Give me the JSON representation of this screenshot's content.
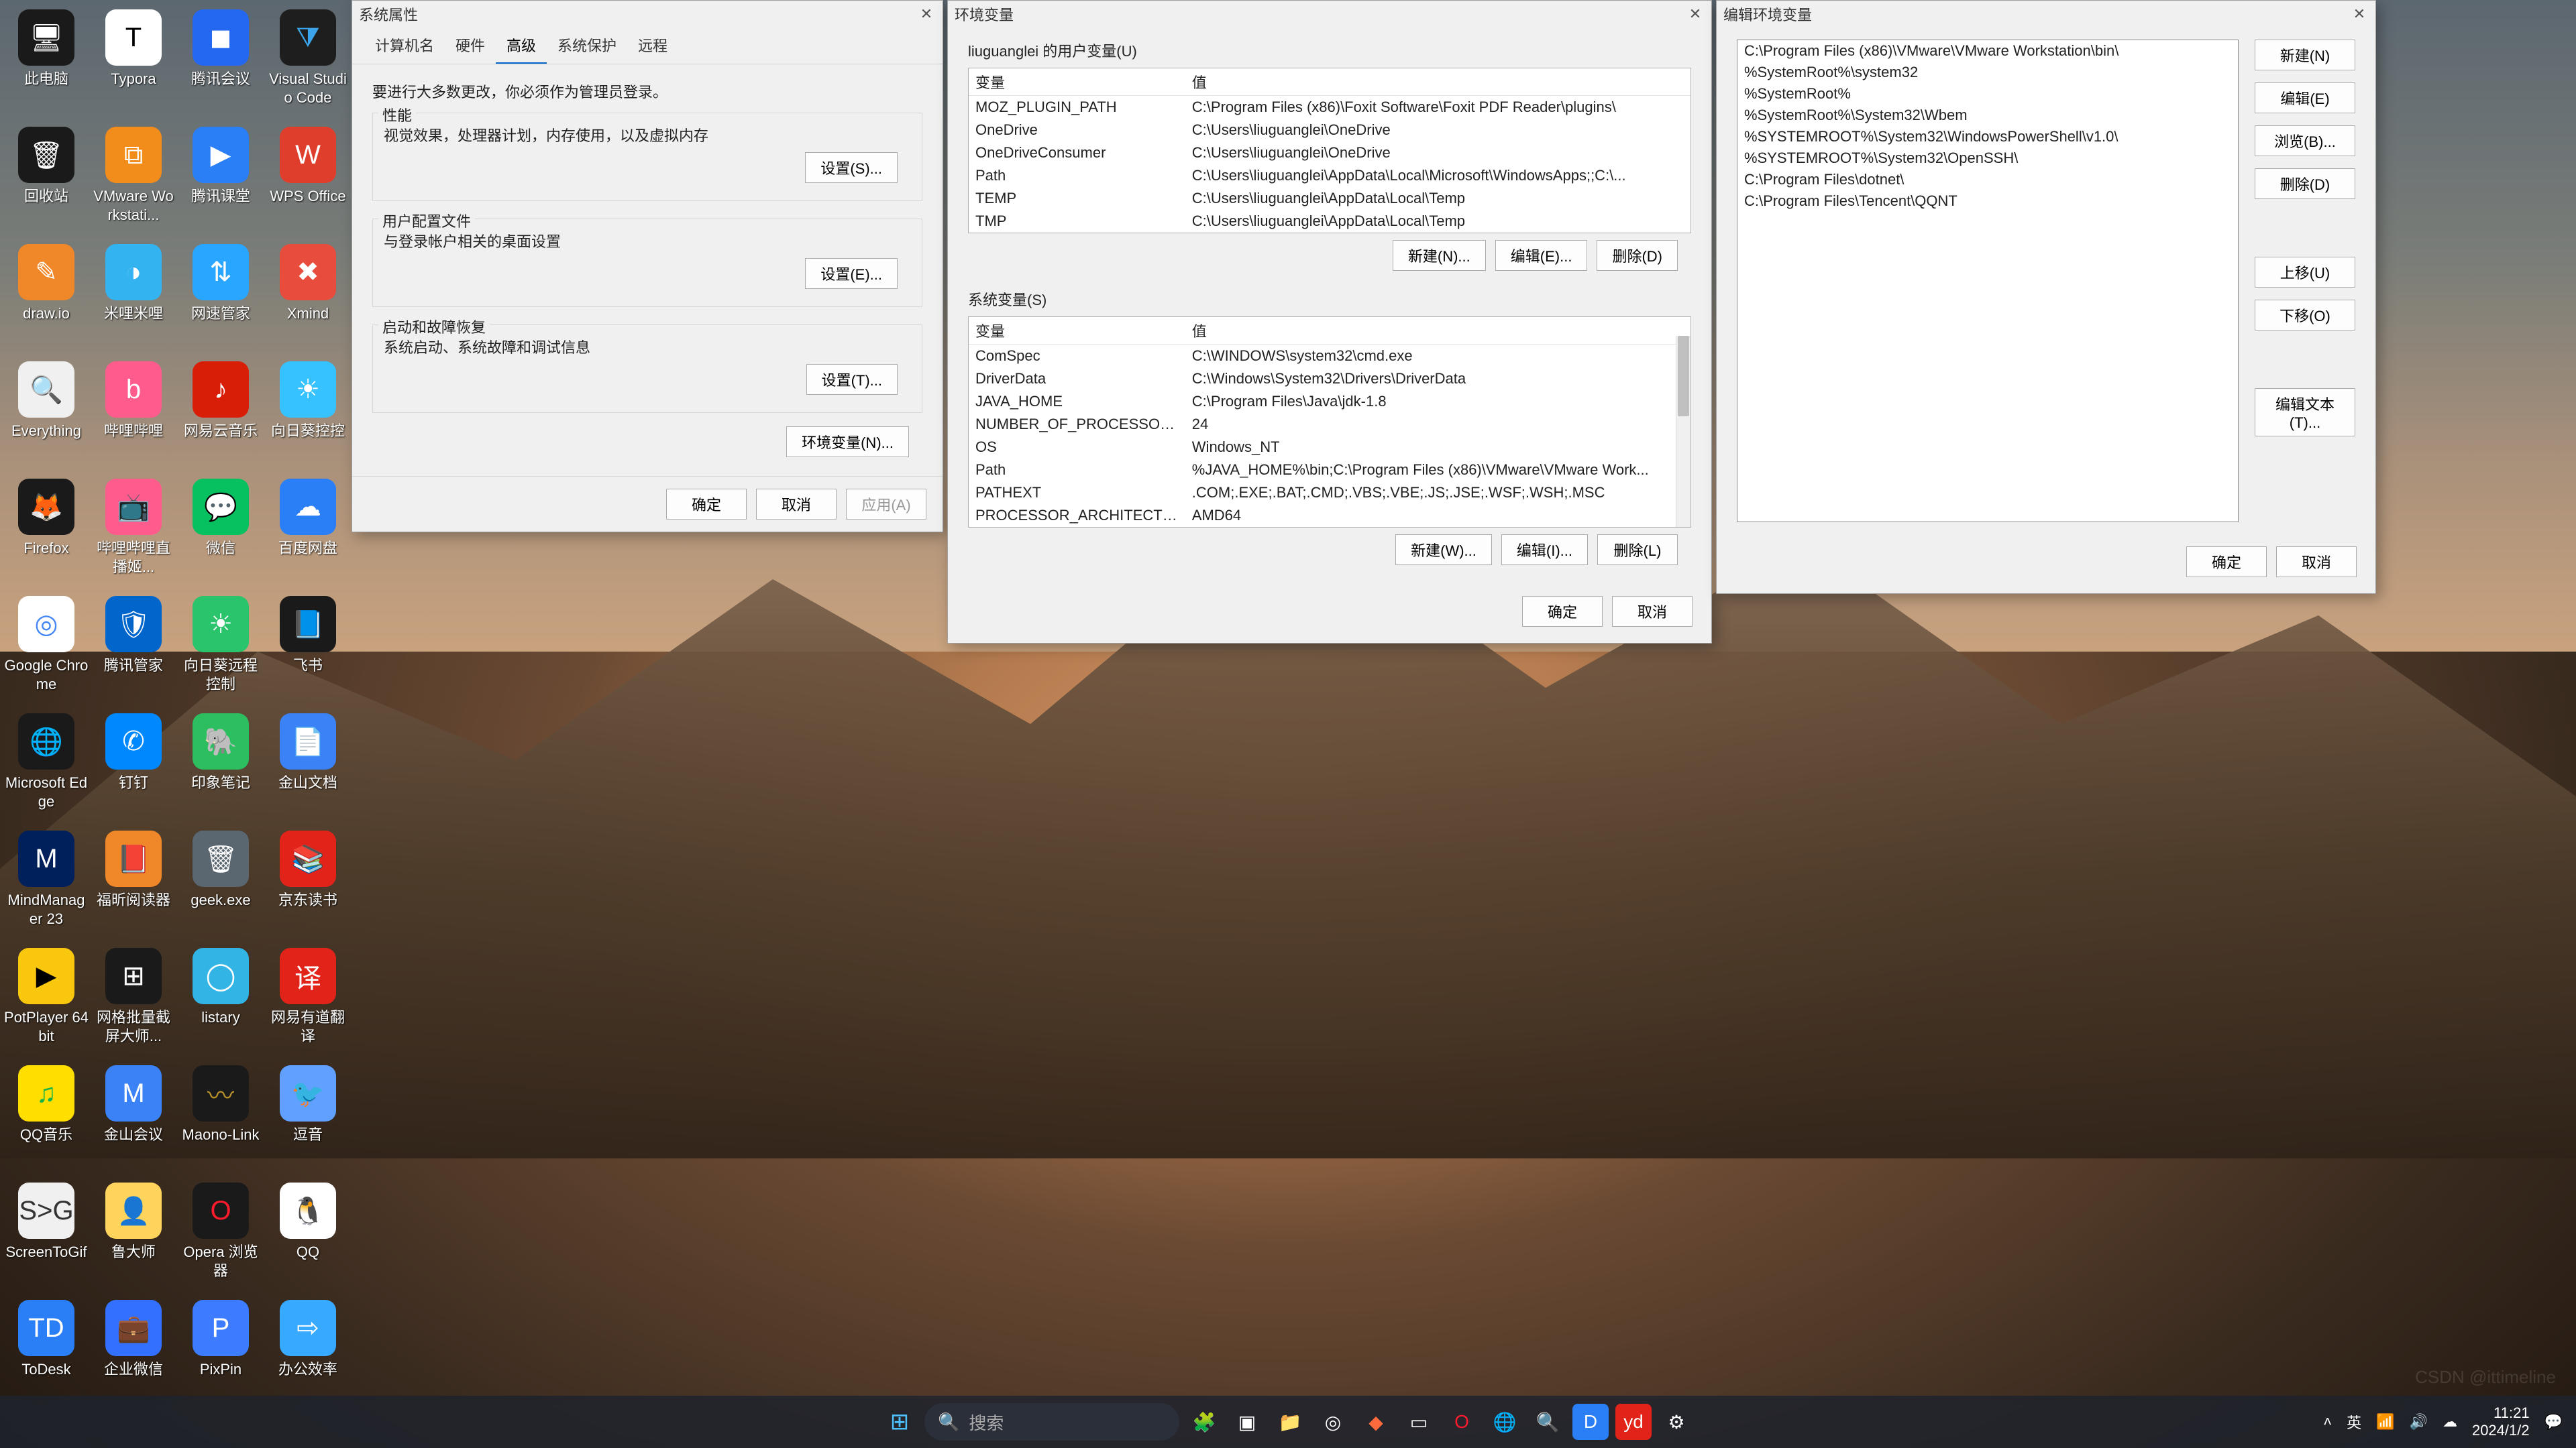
{
  "desktop_icons": [
    {
      "label": "此电脑",
      "bg": "#1a1a1a",
      "glyph": "🖥"
    },
    {
      "label": "Typora",
      "bg": "#ffffff",
      "glyph": "T",
      "fg": "#000"
    },
    {
      "label": "腾讯会议",
      "bg": "#2468f2",
      "glyph": "◼"
    },
    {
      "label": "Visual Studio Code",
      "bg": "#1e1e1e",
      "glyph": "⧩",
      "fg": "#3ba4ea"
    },
    {
      "label": "回收站",
      "bg": "#1a1a1a",
      "glyph": "🗑"
    },
    {
      "label": "VMware Workstati...",
      "bg": "#f28c1b",
      "glyph": "⧉"
    },
    {
      "label": "腾讯课堂",
      "bg": "#2a7ef6",
      "glyph": "▶"
    },
    {
      "label": "WPS Office",
      "bg": "#e03e2d",
      "glyph": "W"
    },
    {
      "label": "draw.io",
      "bg": "#f08728",
      "glyph": "✎"
    },
    {
      "label": "米哩米哩",
      "bg": "#34b3f1",
      "glyph": "◑"
    },
    {
      "label": "网速管家",
      "bg": "#29a6ff",
      "glyph": "⇅"
    },
    {
      "label": "Xmind",
      "bg": "#e74c3c",
      "glyph": "✖"
    },
    {
      "label": "Everything",
      "bg": "#f0f0f0",
      "glyph": "🔍",
      "fg": "#f90"
    },
    {
      "label": "哔哩哔哩",
      "bg": "#ff5c8d",
      "glyph": "b"
    },
    {
      "label": "网易云音乐",
      "bg": "#d81e06",
      "glyph": "♪"
    },
    {
      "label": "向日葵控控",
      "bg": "#36c2ff",
      "glyph": "☀"
    },
    {
      "label": "Firefox",
      "bg": "#1a1a1a",
      "glyph": "🦊"
    },
    {
      "label": "哔哩哔哩直播姬...",
      "bg": "#ff5c8d",
      "glyph": "📺"
    },
    {
      "label": "微信",
      "bg": "#07c160",
      "glyph": "💬"
    },
    {
      "label": "百度网盘",
      "bg": "#2a7ef6",
      "glyph": "☁"
    },
    {
      "label": "Google Chrome",
      "bg": "#fff",
      "glyph": "◎",
      "fg": "#4285f4"
    },
    {
      "label": "腾讯管家",
      "bg": "#0066cc",
      "glyph": "🛡"
    },
    {
      "label": "向日葵远程控制",
      "bg": "#29c46b",
      "glyph": "☀"
    },
    {
      "label": "飞书",
      "bg": "#1a1a1a",
      "glyph": "📘"
    },
    {
      "label": "Microsoft Edge",
      "bg": "#1a1a1a",
      "glyph": "🌐"
    },
    {
      "label": "钉钉",
      "bg": "#0089ff",
      "glyph": "✆"
    },
    {
      "label": "印象笔记",
      "bg": "#2dbe60",
      "glyph": "🐘"
    },
    {
      "label": "金山文档",
      "bg": "#3b82f6",
      "glyph": "📄"
    },
    {
      "label": "MindManager 23",
      "bg": "#00205b",
      "glyph": "M"
    },
    {
      "label": "福昕阅读器",
      "bg": "#f08728",
      "glyph": "📕"
    },
    {
      "label": "geek.exe",
      "bg": "#5b6770",
      "glyph": "🗑"
    },
    {
      "label": "京东读书",
      "bg": "#e2231a",
      "glyph": "📚"
    },
    {
      "label": "PotPlayer 64 bit",
      "bg": "#f9c80e",
      "glyph": "▶",
      "fg": "#000"
    },
    {
      "label": "网格批量截屏大师...",
      "bg": "#1a1a1a",
      "glyph": "⊞"
    },
    {
      "label": "listary",
      "bg": "#32b5e5",
      "glyph": "◯"
    },
    {
      "label": "网易有道翻译",
      "bg": "#e2231a",
      "glyph": "译"
    },
    {
      "label": "QQ音乐",
      "bg": "#ffde00",
      "glyph": "♫",
      "fg": "#11b34a"
    },
    {
      "label": "金山会议",
      "bg": "#3b82f6",
      "glyph": "M"
    },
    {
      "label": "Maono-Link",
      "bg": "#1a1a1a",
      "glyph": "〰",
      "fg": "#b8912a"
    },
    {
      "label": "逗音",
      "bg": "#61a0ff",
      "glyph": "🐦"
    },
    {
      "label": "ScreenToGif",
      "bg": "#f0f0f0",
      "glyph": "S>G",
      "fg": "#333"
    },
    {
      "label": "鲁大师",
      "bg": "#ffd45c",
      "glyph": "👤"
    },
    {
      "label": "Opera 浏览器",
      "bg": "#1a1a1a",
      "glyph": "O",
      "fg": "#ff1b2d"
    },
    {
      "label": "QQ",
      "bg": "#fff",
      "glyph": "🐧",
      "fg": "#000"
    },
    {
      "label": "ToDesk",
      "bg": "#2a7ef6",
      "glyph": "TD"
    },
    {
      "label": "企业微信",
      "bg": "#3370ff",
      "glyph": "💼"
    },
    {
      "label": "PixPin",
      "bg": "#3d7cff",
      "glyph": "P"
    },
    {
      "label": "办公效率",
      "bg": "#37aaff",
      "glyph": "⇨"
    }
  ],
  "win1": {
    "title": "系统属性",
    "tabs": [
      "计算机名",
      "硬件",
      "高级",
      "系统保护",
      "远程"
    ],
    "active_tab": 2,
    "admin_note": "要进行大多数更改，你必须作为管理员登录。",
    "perf_group": "性能",
    "perf_desc": "视觉效果，处理器计划，内存使用，以及虚拟内存",
    "settings_s": "设置(S)...",
    "profile_group": "用户配置文件",
    "profile_desc": "与登录帐户相关的桌面设置",
    "settings_e": "设置(E)...",
    "startup_group": "启动和故障恢复",
    "startup_desc": "系统启动、系统故障和调试信息",
    "settings_t": "设置(T)...",
    "env_btn": "环境变量(N)...",
    "ok": "确定",
    "cancel": "取消",
    "apply": "应用(A)"
  },
  "win2": {
    "title": "环境变量",
    "user_vars_title": "liuguanglei 的用户变量(U)",
    "col_var": "变量",
    "col_val": "值",
    "user_vars": [
      {
        "k": "MOZ_PLUGIN_PATH",
        "v": "C:\\Program Files (x86)\\Foxit Software\\Foxit PDF Reader\\plugins\\"
      },
      {
        "k": "OneDrive",
        "v": "C:\\Users\\liuguanglei\\OneDrive"
      },
      {
        "k": "OneDriveConsumer",
        "v": "C:\\Users\\liuguanglei\\OneDrive"
      },
      {
        "k": "Path",
        "v": "C:\\Users\\liuguanglei\\AppData\\Local\\Microsoft\\WindowsApps;;C:\\..."
      },
      {
        "k": "TEMP",
        "v": "C:\\Users\\liuguanglei\\AppData\\Local\\Temp"
      },
      {
        "k": "TMP",
        "v": "C:\\Users\\liuguanglei\\AppData\\Local\\Temp"
      }
    ],
    "new_n": "新建(N)...",
    "edit_e": "编辑(E)...",
    "del_d": "删除(D)",
    "sys_vars_title": "系统变量(S)",
    "sys_vars": [
      {
        "k": "ComSpec",
        "v": "C:\\WINDOWS\\system32\\cmd.exe"
      },
      {
        "k": "DriverData",
        "v": "C:\\Windows\\System32\\Drivers\\DriverData"
      },
      {
        "k": "JAVA_HOME",
        "v": "C:\\Program Files\\Java\\jdk-1.8"
      },
      {
        "k": "NUMBER_OF_PROCESSORS",
        "v": "24"
      },
      {
        "k": "OS",
        "v": "Windows_NT"
      },
      {
        "k": "Path",
        "v": "%JAVA_HOME%\\bin;C:\\Program Files (x86)\\VMware\\VMware Work..."
      },
      {
        "k": "PATHEXT",
        "v": ".COM;.EXE;.BAT;.CMD;.VBS;.VBE;.JS;.JSE;.WSF;.WSH;.MSC"
      },
      {
        "k": "PROCESSOR_ARCHITECTURE",
        "v": "AMD64"
      }
    ],
    "new_w": "新建(W)...",
    "edit_i": "编辑(I)...",
    "del_l": "删除(L)",
    "ok": "确定",
    "cancel": "取消"
  },
  "win3": {
    "title": "编辑环境变量",
    "paths": [
      "C:\\Program Files (x86)\\VMware\\VMware Workstation\\bin\\",
      "%SystemRoot%\\system32",
      "%SystemRoot%",
      "%SystemRoot%\\System32\\Wbem",
      "%SYSTEMROOT%\\System32\\WindowsPowerShell\\v1.0\\",
      "%SYSTEMROOT%\\System32\\OpenSSH\\",
      "C:\\Program Files\\dotnet\\",
      "C:\\Program Files\\Tencent\\QQNT"
    ],
    "new": "新建(N)",
    "edit": "编辑(E)",
    "browse": "浏览(B)...",
    "del": "删除(D)",
    "up": "上移(U)",
    "down": "下移(O)",
    "edit_text": "编辑文本(T)...",
    "ok": "确定",
    "cancel": "取消"
  },
  "taskbar": {
    "search_placeholder": "搜索",
    "ime": "英",
    "time": "11:21",
    "date": "2024/1/2"
  },
  "watermark": "CSDN @ittimeline"
}
